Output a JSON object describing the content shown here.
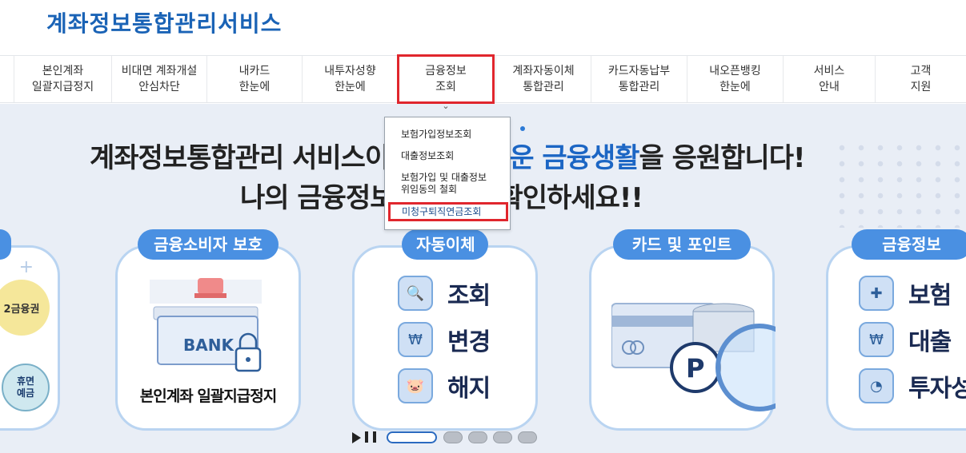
{
  "header": {
    "logo_text": "계좌정보통합관리서비스"
  },
  "nav": {
    "items": [
      {
        "line1": "본인계좌",
        "line2": "일괄지급정지"
      },
      {
        "line1": "비대면 계좌개설",
        "line2": "안심차단"
      },
      {
        "line1": "내카드",
        "line2": "한눈에"
      },
      {
        "line1": "내투자성향",
        "line2": "한눈에"
      },
      {
        "line1": "금융정보",
        "line2": "조회"
      },
      {
        "line1": "계좌자동이체",
        "line2": "통합관리"
      },
      {
        "line1": "카드자동납부",
        "line2": "통합관리"
      },
      {
        "line1": "내오픈뱅킹",
        "line2": "한눈에"
      },
      {
        "line1": "서비스",
        "line2": "안내"
      },
      {
        "line1": "고객",
        "line2": "지원"
      }
    ],
    "active_index": 4
  },
  "dropdown": {
    "items": [
      "보험가입정보조회",
      "대출정보조회",
      "보험가입 및 대출정보",
      "위임동의 철회",
      "미청구퇴직연금조회"
    ]
  },
  "hero": {
    "line1_a": "계좌정보통합관리 서비스이",
    "line1_b": "운 금융생활",
    "line1_c": "을 응원합니다!",
    "line2_a": "나의 금융정보",
    "line2_b": "확인하세요!!"
  },
  "cards": {
    "partial_left": {
      "badge1": "2금융권",
      "badge2a": "휴면",
      "badge2b": "예금"
    },
    "consumer": {
      "tag": "금융소비자 보호",
      "bank_label": "BANK",
      "caption": "본인계좌 일괄지급정지"
    },
    "auto": {
      "tag": "자동이체",
      "rows": [
        "조회",
        "변경",
        "해지"
      ]
    },
    "card_points": {
      "tag": "카드 및 포인트",
      "p_label": "P"
    },
    "fin_info": {
      "tag": "금융정보",
      "rows": [
        "보험",
        "대출",
        "투자성"
      ]
    }
  },
  "colors": {
    "brand_blue": "#1a63b6",
    "highlight_red": "#e0262d",
    "tag_blue": "#4a90e2",
    "hero_bg": "#e9eef6"
  }
}
